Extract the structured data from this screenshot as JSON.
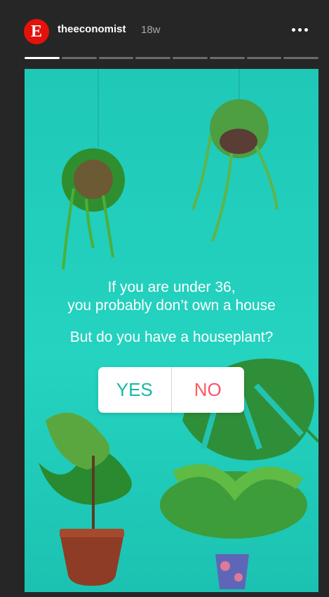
{
  "header": {
    "avatar_letter": "E",
    "username": "theeconomist",
    "timestamp": "18w",
    "progress_segments": 8,
    "active_segment": 1
  },
  "story": {
    "line1": "If you are under 36,",
    "line2": "you probably don’t own a house",
    "question": "But do you have a houseplant?",
    "poll_yes": "YES",
    "poll_no": "NO",
    "background_color": "#22cdbb"
  }
}
